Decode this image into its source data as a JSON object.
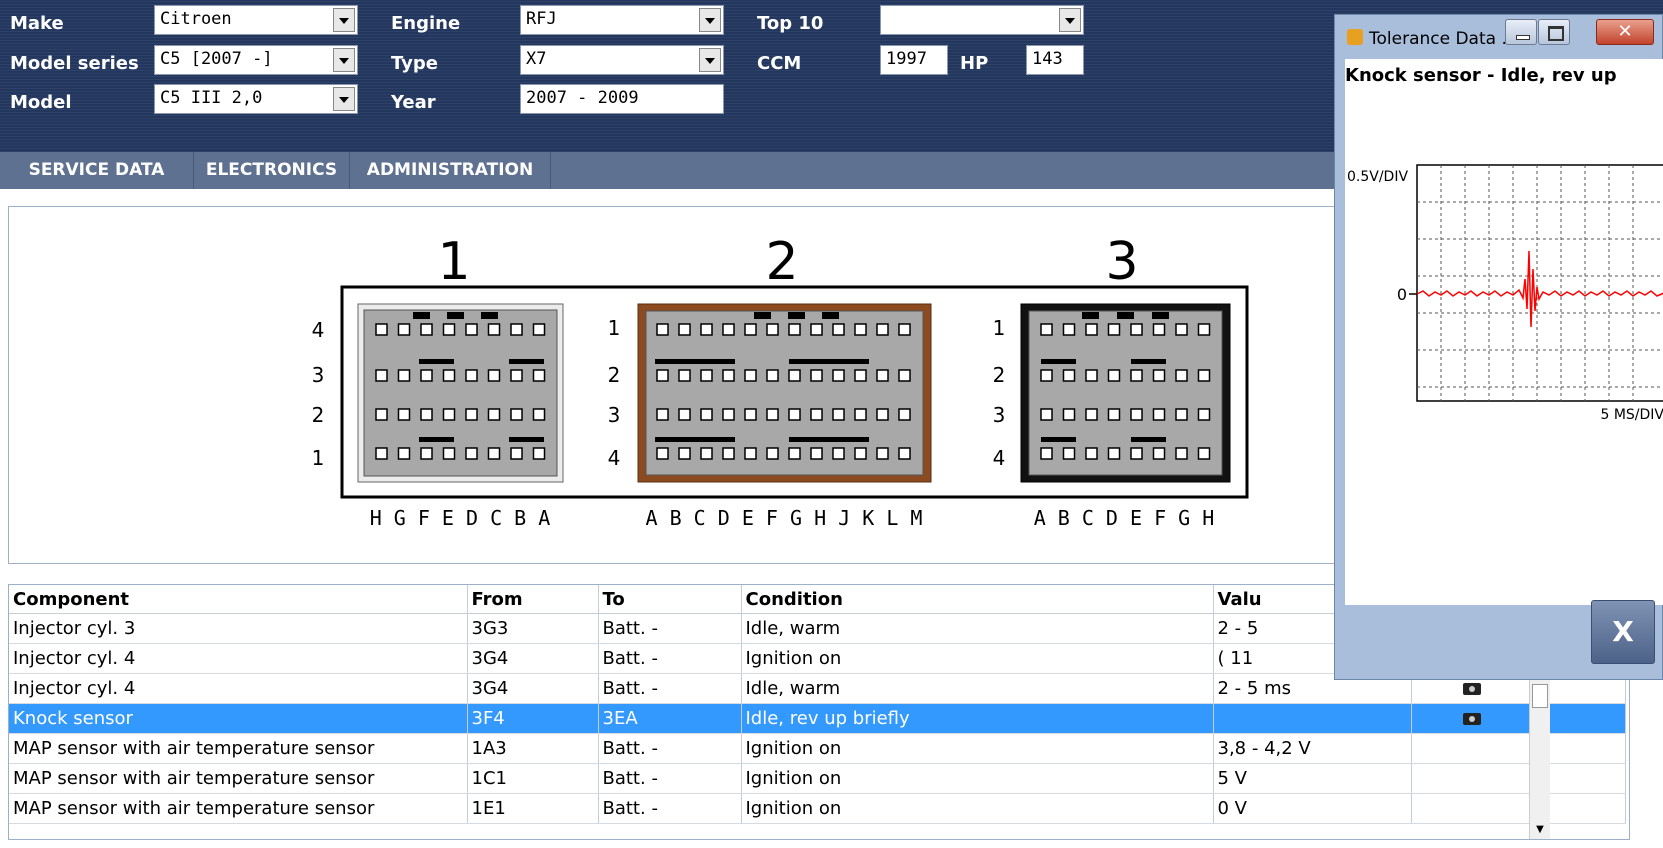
{
  "vehicle": {
    "make_label": "Make",
    "make_value": "Citroen",
    "model_series_label": "Model series",
    "model_series_value": "C5 [2007 -]",
    "model_label": "Model",
    "model_value": "C5 III 2,0",
    "engine_label": "Engine",
    "engine_value": "RFJ",
    "type_label": "Type",
    "type_value": "X7",
    "year_label": "Year",
    "year_value": "2007 - 2009",
    "top10_label": "Top 10",
    "top10_value": "",
    "ccm_label": "CCM",
    "ccm_value": "1997",
    "hp_label": "HP",
    "hp_value": "143"
  },
  "nav": {
    "tabs": [
      "SERVICE DATA",
      "ELECTRONICS",
      "ADMINISTRATION"
    ]
  },
  "diagram": {
    "connectors": [
      {
        "number": "1",
        "rows": [
          "4",
          "3",
          "2",
          "1"
        ],
        "pins": "H G F E D C B A",
        "color": "#a8a8a8"
      },
      {
        "number": "2",
        "rows": [
          "1",
          "2",
          "3",
          "4"
        ],
        "pins": "A B C D E F G H J K L M",
        "color": "#8b4a1f"
      },
      {
        "number": "3",
        "rows": [
          "1",
          "2",
          "3",
          "4"
        ],
        "pins": "A B C D E F G H",
        "color": "#111111"
      }
    ]
  },
  "table": {
    "headers": [
      "Component",
      "From",
      "To",
      "Condition",
      "Valu"
    ],
    "rows": [
      {
        "component": "Injector cyl. 3",
        "from": "3G3",
        "to": "Batt. -",
        "condition": "Idle, warm",
        "value": "2 - 5",
        "camera": false
      },
      {
        "component": "Injector cyl. 4",
        "from": "3G4",
        "to": "Batt. -",
        "condition": "Ignition on",
        "value": "( 11",
        "camera": false
      },
      {
        "component": "Injector cyl. 4",
        "from": "3G4",
        "to": "Batt. -",
        "condition": "Idle, warm",
        "value": "2 - 5 ms",
        "camera": true
      },
      {
        "component": "Knock sensor",
        "from": "3F4",
        "to": "3EA",
        "condition": "Idle, rev up briefly",
        "value": "",
        "camera": true,
        "selected": true
      },
      {
        "component": "MAP sensor with air temperature sensor",
        "from": "1A3",
        "to": "Batt. -",
        "condition": "Ignition on",
        "value": "3,8 - 4,2 V",
        "camera": false
      },
      {
        "component": "MAP sensor with air temperature sensor",
        "from": "1C1",
        "to": "Batt. -",
        "condition": "Ignition on",
        "value": "5 V",
        "camera": false
      },
      {
        "component": "MAP sensor with air temperature sensor",
        "from": "1E1",
        "to": "Batt. -",
        "condition": "Ignition on",
        "value": "0 V",
        "camera": false
      }
    ]
  },
  "popup": {
    "title": "Tolerance Data ...",
    "heading": "Knock sensor - Idle, rev up",
    "scope": {
      "y_scale": "0.5V/DIV",
      "zero_label": "0",
      "x_scale": "5 MS/DIV"
    },
    "close_label": "X"
  },
  "colors": {
    "header_bg": "#23375e",
    "nav_bg": "#5f7191",
    "selected_row": "#3399ff",
    "signal": "#ff0000"
  }
}
